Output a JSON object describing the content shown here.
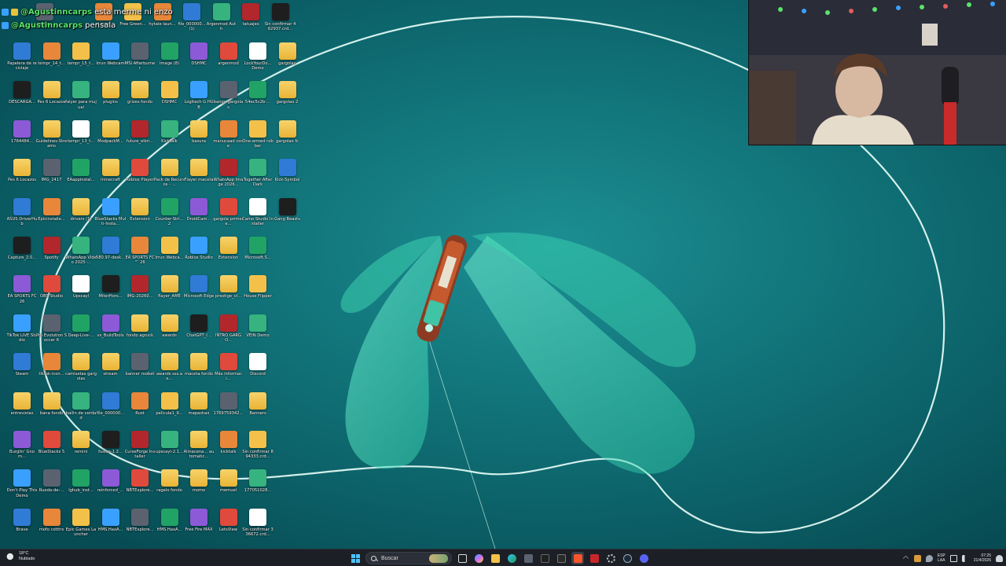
{
  "chat": [
    {
      "user": "@Agustinncarps",
      "message": "esta merme ni enzo"
    },
    {
      "user": "@Agustinncarps",
      "message": "pensala"
    }
  ],
  "desktop_icons": [
    [
      "Papelera de reciclaje",
      "DESCARGA...",
      "1764484...",
      "Pes 6 Locazos",
      "ASUS DriverHub",
      "Capture_2.0...",
      "EA SPORTS FC 26",
      "TikTok LIVE Studio",
      "Steam",
      "entrevistas",
      "Burglin' Gnom...",
      "Don't Play This Demo",
      "Brave"
    ],
    [
      "tempr_14_t...",
      "Pes 6 Locazos",
      "Guidelines-Streams",
      "IMG_2417",
      "Epicinstalle...",
      "Spotify",
      "OBS Studio",
      "Pro Evolution Soccer 6",
      "tiktok-icon...",
      "bana fondo",
      "BlueStacks 5",
      "Rueda-de-...",
      "mofo cstttrs"
    ],
    [
      "tempr_15_t...",
      "falyer para mujual",
      "tempr_13_t...",
      "EAappinstal...",
      "drivers (1)",
      "WhatsApp Video 2025-...",
      "Upscayl",
      "Deep-Live-...",
      "camisetas gargolas",
      "bailin de verdad",
      "remini",
      "lghub_inst...",
      "Epic Games Launcher"
    ],
    [
      "Irrun Webcam",
      "plugins",
      "ModpackM...",
      "minecraft",
      "BlueStacks Multi-Insta...",
      "580.97-desk...",
      "MiterHors...",
      "vs_BuildTools",
      "stream",
      "file_000000...",
      "fusion-1.2...",
      "reinforced_...",
      "HMS.HaxA..."
    ],
    [
      "MSI Afterburner",
      "grizes fondo",
      "future_elim...",
      "Roblox Player",
      "Extension",
      "EA SPORTS FC™ 26",
      "IMG-20260...",
      "fondo agruck",
      "banner roobet",
      "Rust",
      "CurseForge Installer",
      "NBTExplore...",
      "NBTExplore..."
    ],
    [
      "image (8)",
      "DSHMC",
      "KickTalk",
      "Pack de Recursos - ...",
      "Counter-Stri... 2",
      "Irrun Webca...",
      "flayer_AME",
      "awards",
      "awards sss.ae...",
      "pelicula1_9...",
      "upscayl-2.1...",
      "ragelo fondo",
      "HMS.HaxA..."
    ],
    [
      "DSHMC",
      "Logitech G HUB",
      "basura",
      "Flayer maceta",
      "DroidCam...",
      "Roblox Studio",
      "Microsoft Edge",
      "ChatGPT_I...",
      "maceta fondo",
      "mapashax",
      "Almacena... automatic...",
      "momo",
      "Free Fire MAX"
    ],
    [
      "argenmod",
      "bango gargolas",
      "manucaad code",
      "WhatsApp Image 2026...",
      "gargola primer e...",
      "Extension",
      "prestige_vi...",
      "INTRO GARGO...",
      "Más informaci...",
      "1769759342...",
      "kicktalk",
      "memuel",
      "LetsView"
    ],
    [
      "LockYourDo... Demo",
      "54ec5c2b-...",
      "One-armed robber",
      "Together After Dark",
      "Camo Studio Installer",
      "Microsoft.S...",
      "House Flipper",
      "VEIN Demo",
      "Discord",
      "Banners",
      "Sin confirmar 894333.crd...",
      "177051028...",
      "Sin confirmar 336672.crd..."
    ],
    [
      "gargolao",
      "gargolao 2",
      "gargolao fc",
      "Kick-Symbol",
      "Gang Beasts"
    ]
  ],
  "top_row": [
    "Free Green...",
    "hytale-laun...",
    "file_000000... (1)",
    "Argenmod Auth",
    "tatuajes",
    "Sin confirmar 462937.crd..."
  ],
  "top_row_left": [
    "mejor...",
    "..ci sunn..."
  ],
  "taskbar": {
    "weather_temp": "18°C",
    "weather_desc": "Nublado",
    "search_placeholder": "Buscar",
    "lang_top": "ESP",
    "lang_bottom": "LAA",
    "time": "07:25",
    "date": "21/4/2026"
  },
  "colors": {
    "sea": "#0f6e74",
    "net": "#52e8c4",
    "taskbar": "#1c2026",
    "chat_user": "#59e36a"
  }
}
